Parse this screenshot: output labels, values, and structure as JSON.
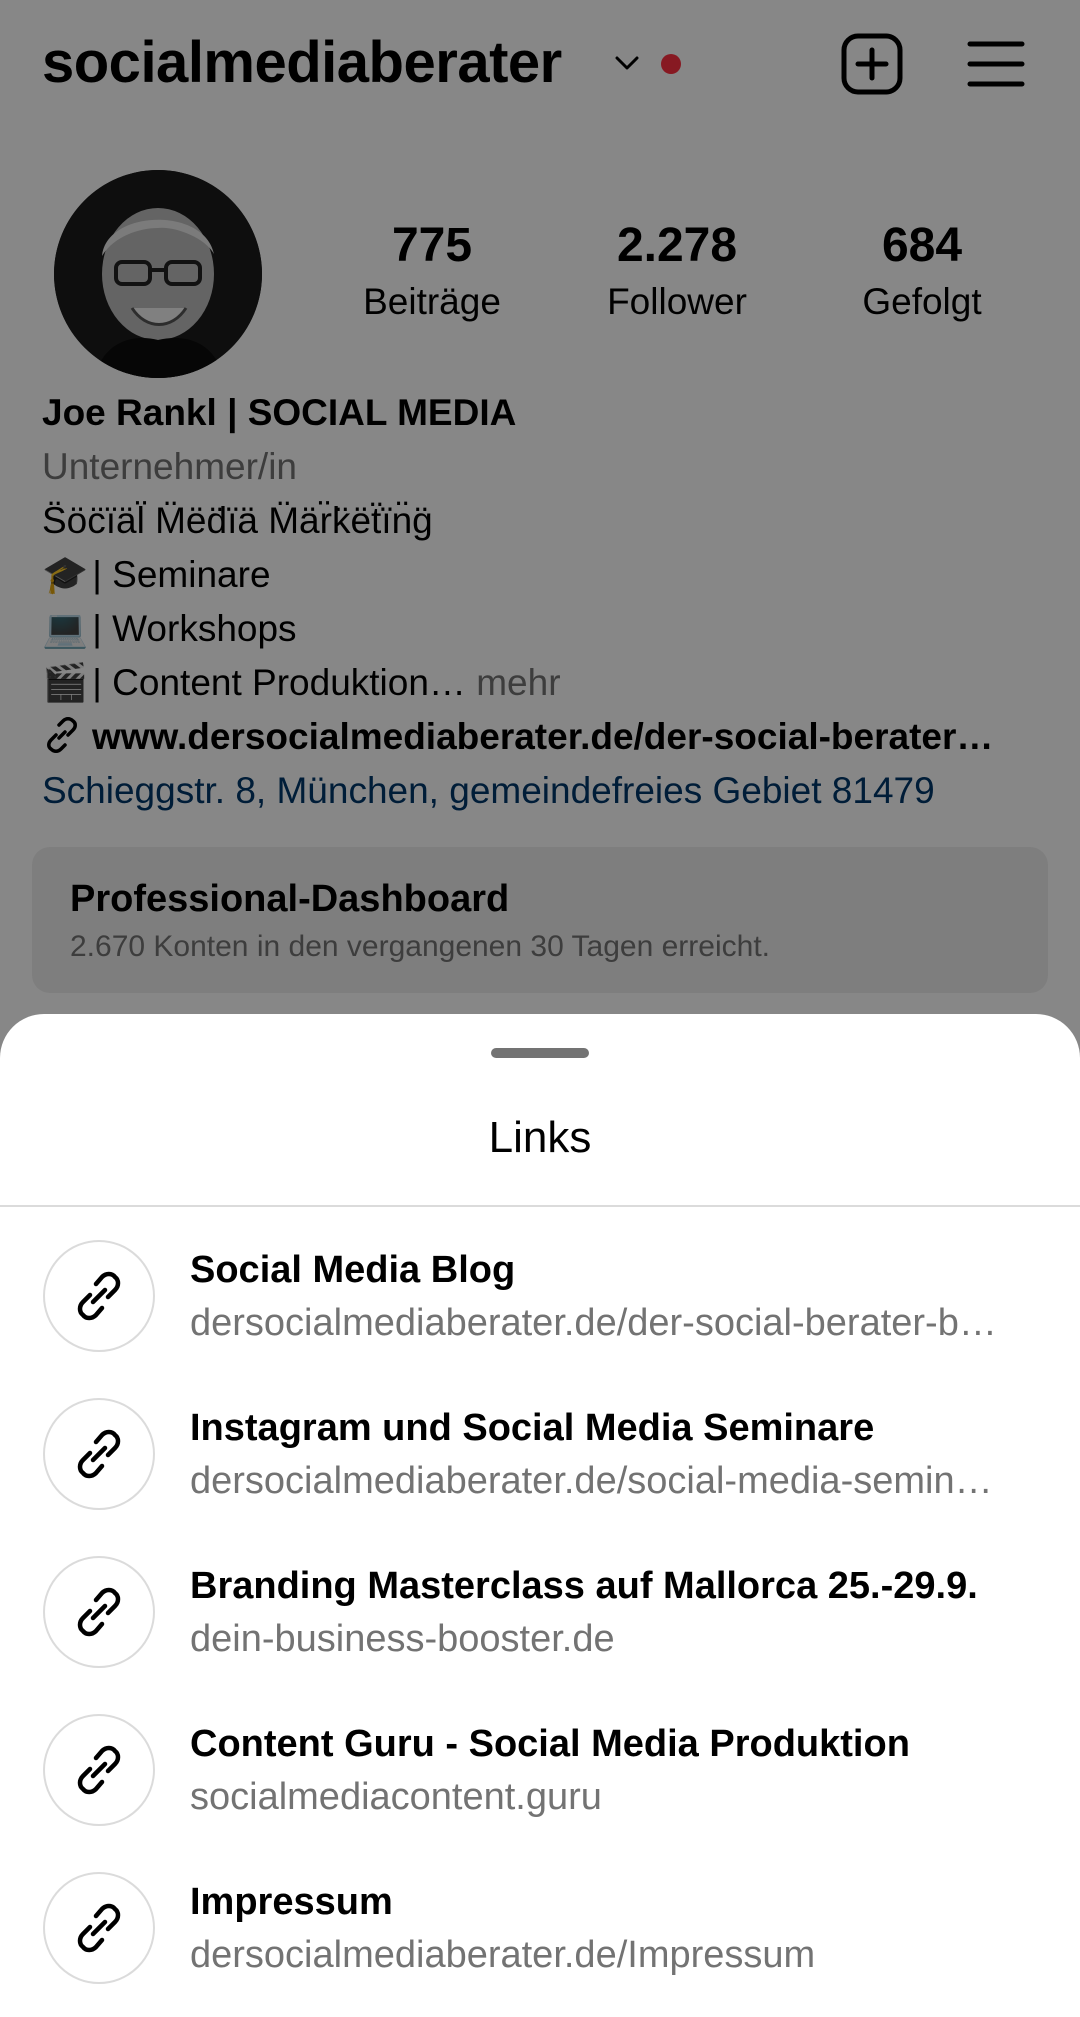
{
  "header": {
    "username": "socialmediaberater",
    "has_notification": true
  },
  "profile": {
    "stats": [
      {
        "value": "775",
        "label": "Beiträge"
      },
      {
        "value": "2.278",
        "label": "Follower"
      },
      {
        "value": "684",
        "label": "Gefolgt"
      }
    ],
    "name": "Joe Rankl | SOCIAL MEDIA",
    "category": "Unternehmer/in",
    "bio_lines": [
      "S̈öc̈ïäl̈ M̈ëd̈ïä M̈är̈k̈ëẗïn̈g̈",
      "| Seminare",
      "| Workshops",
      "| Content Produktion…"
    ],
    "bio_emojis": [
      "🎓",
      "💻",
      "🎬"
    ],
    "more_label": "mehr",
    "website": "www.dersocialmediaberater.de/der-social-berater…",
    "address": "Schieggstr. 8, München, gemeindefreies Gebiet 81479"
  },
  "dashboard": {
    "title": "Professional-Dashboard",
    "subtitle": "2.670 Konten in den vergangenen 30 Tagen erreicht."
  },
  "sheet": {
    "title": "Links",
    "links": [
      {
        "title": "Social Media Blog",
        "url": "dersocialmediaberater.de/der-social-berater-b…"
      },
      {
        "title": "Instagram und Social Media Seminare",
        "url": "dersocialmediaberater.de/social-media-semin…"
      },
      {
        "title": "Branding Masterclass auf Mallorca 25.-29.9.",
        "url": "dein-business-booster.de"
      },
      {
        "title": "Content Guru - Social Media Produktion",
        "url": "socialmediacontent.guru"
      },
      {
        "title": "Impressum",
        "url": "dersocialmediaberater.de/Impressum"
      }
    ]
  },
  "icons": {
    "chevron": "chevron-down-icon",
    "add": "add-post-icon",
    "menu": "hamburger-menu-icon",
    "link": "link-icon"
  },
  "colors": {
    "notification_dot": "#ff3040",
    "secondary_text": "#737373",
    "address_link": "#00376b",
    "dashboard_bg": "#efefef",
    "scrim": "rgba(0,0,0,0.47)"
  }
}
